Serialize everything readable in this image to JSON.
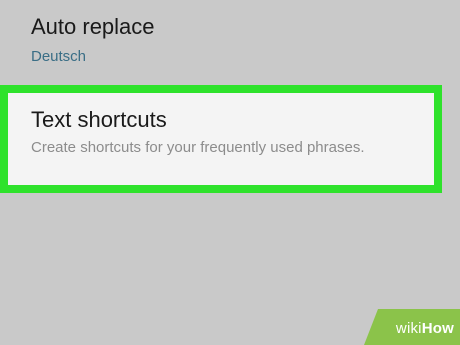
{
  "settings": {
    "auto_replace": {
      "title": "Auto replace",
      "subtitle": "Deutsch"
    },
    "text_shortcuts": {
      "title": "Text shortcuts",
      "subtitle": "Create shortcuts for your frequently used phrases."
    }
  },
  "watermark": {
    "wiki": "wiki",
    "how": "How"
  },
  "colors": {
    "background": "#c9c9c9",
    "highlight": "#2ee22b",
    "item_background": "#f4f4f4",
    "subtitle_accent": "#3a6e86",
    "watermark_green": "#8bc34a"
  }
}
